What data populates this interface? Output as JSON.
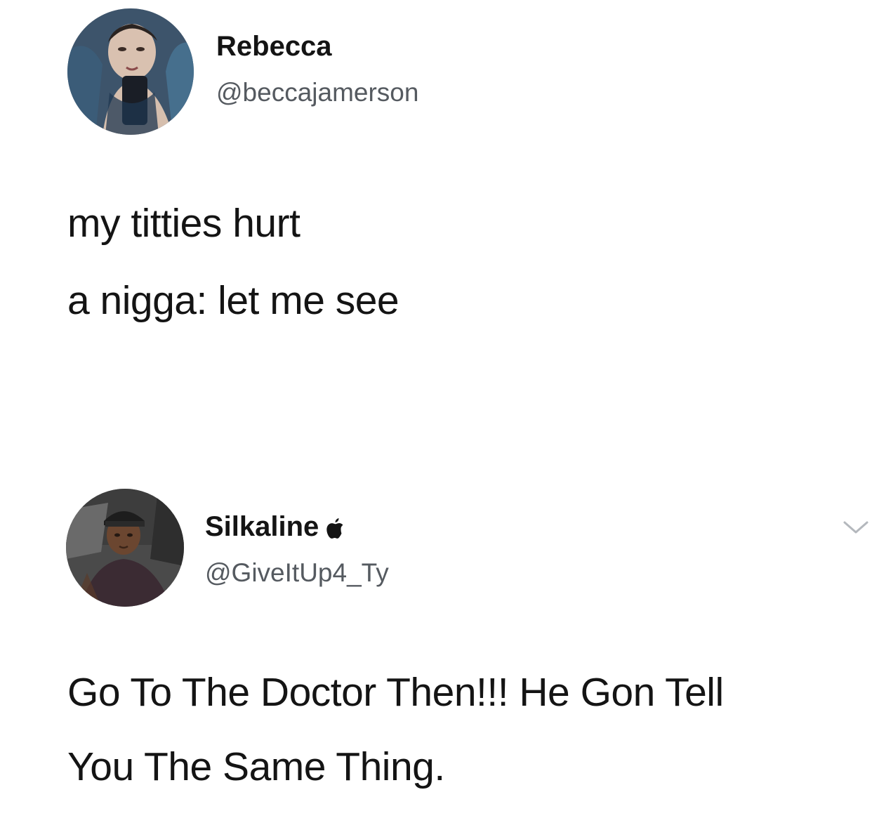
{
  "tweets": [
    {
      "display_name": "Rebecca",
      "handle": "@beccajamerson",
      "lines": [
        "my titties hurt",
        "a nigga: let me see"
      ]
    },
    {
      "display_name": "Silkaline",
      "verified_icon": "apple-icon",
      "handle": "@GiveItUp4_Ty",
      "menu_icon": "chevron-down-icon",
      "lines": [
        "Go To The Doctor Then!!! He Gon Tell",
        "You The Same Thing."
      ]
    }
  ]
}
